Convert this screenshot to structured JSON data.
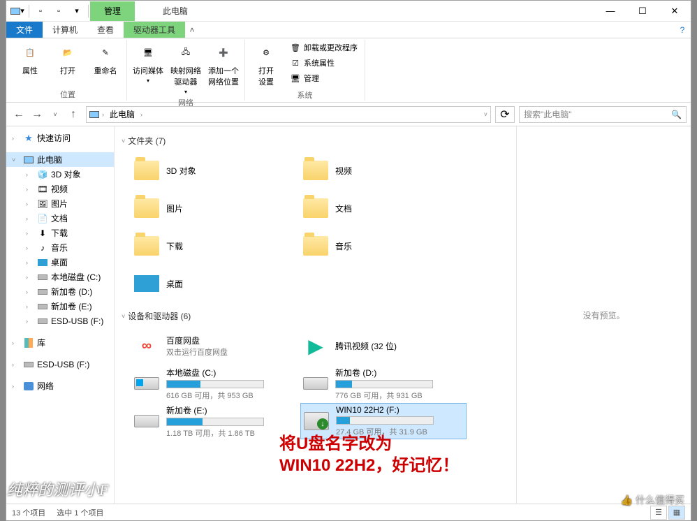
{
  "window": {
    "title": "此电脑",
    "contextual_tab": "管理"
  },
  "tabs": {
    "file": "文件",
    "computer": "计算机",
    "view": "查看",
    "drive_tools": "驱动器工具"
  },
  "ribbon": {
    "location": {
      "properties": "属性",
      "open": "打开",
      "rename": "重命名",
      "group": "位置"
    },
    "network": {
      "media": "访问媒体",
      "map": "映射网络\n驱动器",
      "add": "添加一个\n网络位置",
      "group": "网络"
    },
    "system": {
      "open_settings": "打开\n设置",
      "uninstall": "卸载或更改程序",
      "sys_props": "系统属性",
      "manage": "管理",
      "group": "系统"
    }
  },
  "nav": {
    "location": "此电脑",
    "search_placeholder": "搜索\"此电脑\""
  },
  "tree": {
    "quick": "快速访问",
    "this_pc": "此电脑",
    "objects3d": "3D 对象",
    "videos": "视频",
    "pictures": "图片",
    "documents": "文档",
    "downloads": "下载",
    "music": "音乐",
    "desktop": "桌面",
    "disk_c": "本地磁盘 (C:)",
    "disk_d": "新加卷 (D:)",
    "disk_e": "新加卷 (E:)",
    "esd_usb": "ESD-USB (F:)",
    "libraries": "库",
    "esd_usb2": "ESD-USB (F:)",
    "network": "网络"
  },
  "groups": {
    "folders": "文件夹 (7)",
    "devices": "设备和驱动器 (6)"
  },
  "folders": {
    "objects3d": "3D 对象",
    "videos": "视频",
    "pictures": "图片",
    "documents": "文档",
    "downloads": "下载",
    "music": "音乐",
    "desktop": "桌面"
  },
  "drives": {
    "baidu": {
      "name": "百度网盘",
      "sub": "双击运行百度网盘"
    },
    "tencent": {
      "name": "腾讯视频 (32 位)"
    },
    "c": {
      "name": "本地磁盘 (C:)",
      "space": "616 GB 可用，共 953 GB",
      "pct": 35
    },
    "d": {
      "name": "新加卷 (D:)",
      "space": "776 GB 可用，共 931 GB",
      "pct": 17
    },
    "e": {
      "name": "新加卷 (E:)",
      "space": "1.18 TB 可用，共 1.86 TB",
      "pct": 37
    },
    "f": {
      "name": "WIN10 22H2 (F:)",
      "space": "27.4 GB 可用，共 31.9 GB",
      "pct": 14
    }
  },
  "preview": "没有预览。",
  "status": {
    "count": "13 个项目",
    "selected": "选中 1 个项目"
  },
  "annotation": {
    "line1": "将U盘名字改为",
    "line2": "WIN10 22H2，好记忆！"
  },
  "watermark_left": "纯粹的测评小F",
  "watermark_right": "什么值得买"
}
